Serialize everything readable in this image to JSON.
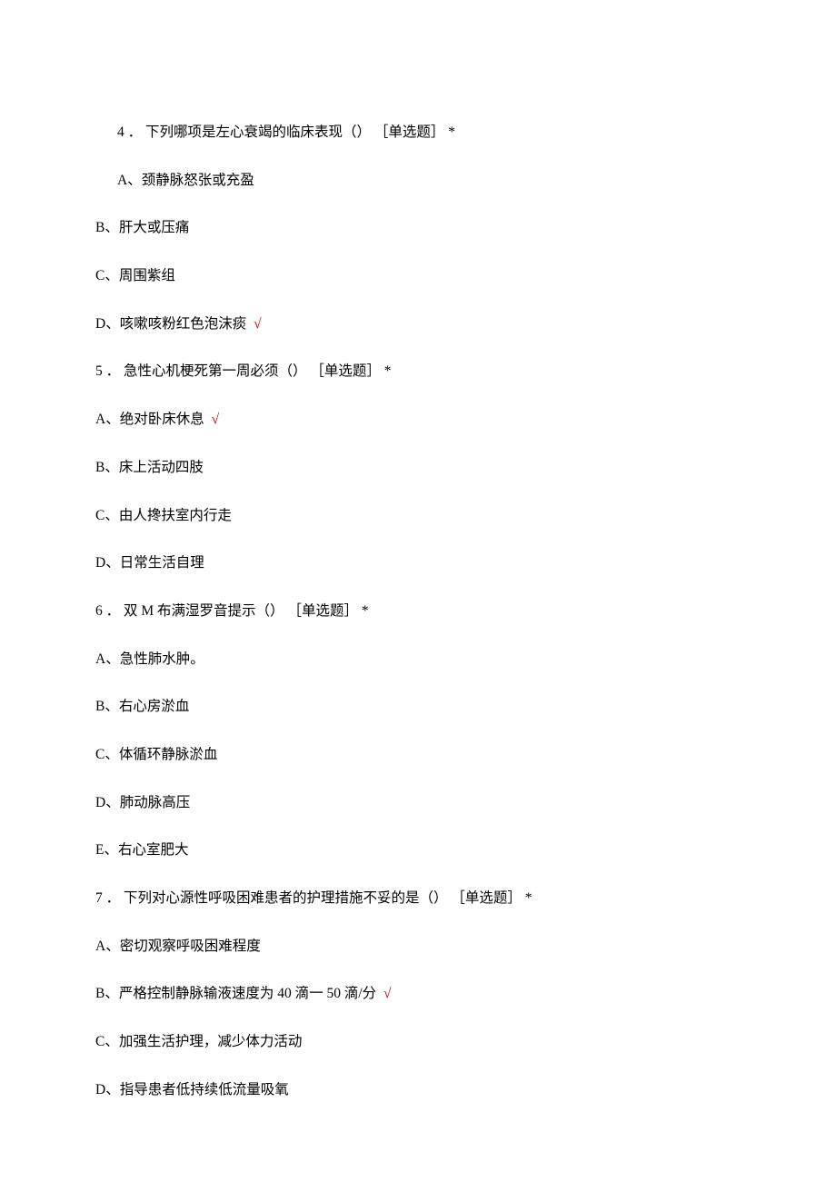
{
  "tag_single": "［单选题］",
  "asterisk": "*",
  "checkmark": "√",
  "q4": {
    "num": "4",
    "dot": "．",
    "text": "下列哪项是左心衰竭的临床表现（）",
    "A": "A、颈静脉怒张或充盈",
    "B": "B、肝大或压痛",
    "C": "C、周围紫组",
    "D": "D、咳嗽咳粉红色泡沫痰",
    "correct": "D"
  },
  "q5": {
    "num": "5",
    "dot": "．",
    "text": "急性心机梗死第一周必须（）",
    "A": "A、绝对卧床休息",
    "B": "B、床上活动四肢",
    "C": "C、由人搀扶室内行走",
    "D": "D、日常生活自理",
    "correct": "A"
  },
  "q6": {
    "num": "6",
    "dot": "．",
    "text": "双 M 布满湿罗音提示（）",
    "A": "A、急性肺水肿。",
    "B": "B、右心房淤血",
    "C": "C、体循环静脉淤血",
    "D": "D、肺动脉高压",
    "E": "E、右心室肥大",
    "correct": ""
  },
  "q7": {
    "num": "7",
    "dot": "．",
    "text": "下列对心源性呼吸困难患者的护理措施不妥的是（）",
    "A": "A、密切观察呼吸困难程度",
    "B": "B、严格控制静脉输液速度为 40 滴一 50 滴/分",
    "C": "C、加强生活护理，减少体力活动",
    "D": "D、指导患者低持续低流量吸氧",
    "correct": "B"
  }
}
